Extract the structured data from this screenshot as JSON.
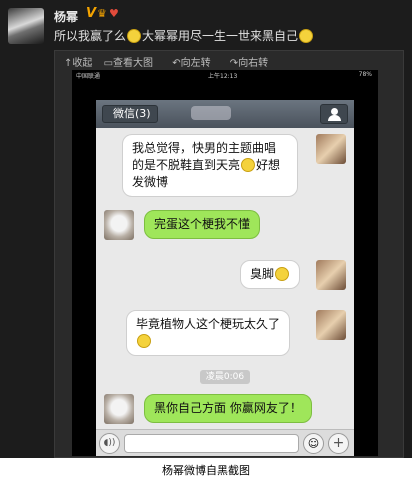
{
  "post": {
    "username": "杨幂",
    "verified_badge": "V",
    "text_before": "所以我赢了么",
    "text_middle": "大幂幂用尽一生一世来黑自己",
    "toolbar": [
      {
        "icon": "collapse-icon",
        "label": "↑收起"
      },
      {
        "icon": "zoom-icon",
        "label": "查看大图"
      },
      {
        "icon": "rotate-left-icon",
        "label": "向左转"
      },
      {
        "icon": "rotate-right-icon",
        "label": "向右转"
      }
    ]
  },
  "phone": {
    "carrier": "中国联通",
    "time": "上午12:13",
    "battery": "78%"
  },
  "chat": {
    "back_label": "微信(3)",
    "messages": [
      {
        "side": "in",
        "lines": [
          "我总觉得，快男的主题曲唱",
          "的是不脱鞋直到天亮",
          "好想",
          "发微博"
        ]
      },
      {
        "side": "out",
        "text": "完蛋这个梗我不懂"
      },
      {
        "side": "in",
        "text": "臭脚"
      },
      {
        "side": "in",
        "text": "毕竟植物人这个梗玩太久了"
      },
      {
        "side": "out",
        "text": "黑你自己方面 你赢网友了！"
      }
    ],
    "timestamp": "凌晨0:06"
  },
  "caption": "杨幂微博自黑截图",
  "colors": {
    "outgoing": "#9fe65a",
    "incoming": "#ffffff",
    "frame": "#1c1c1c"
  }
}
